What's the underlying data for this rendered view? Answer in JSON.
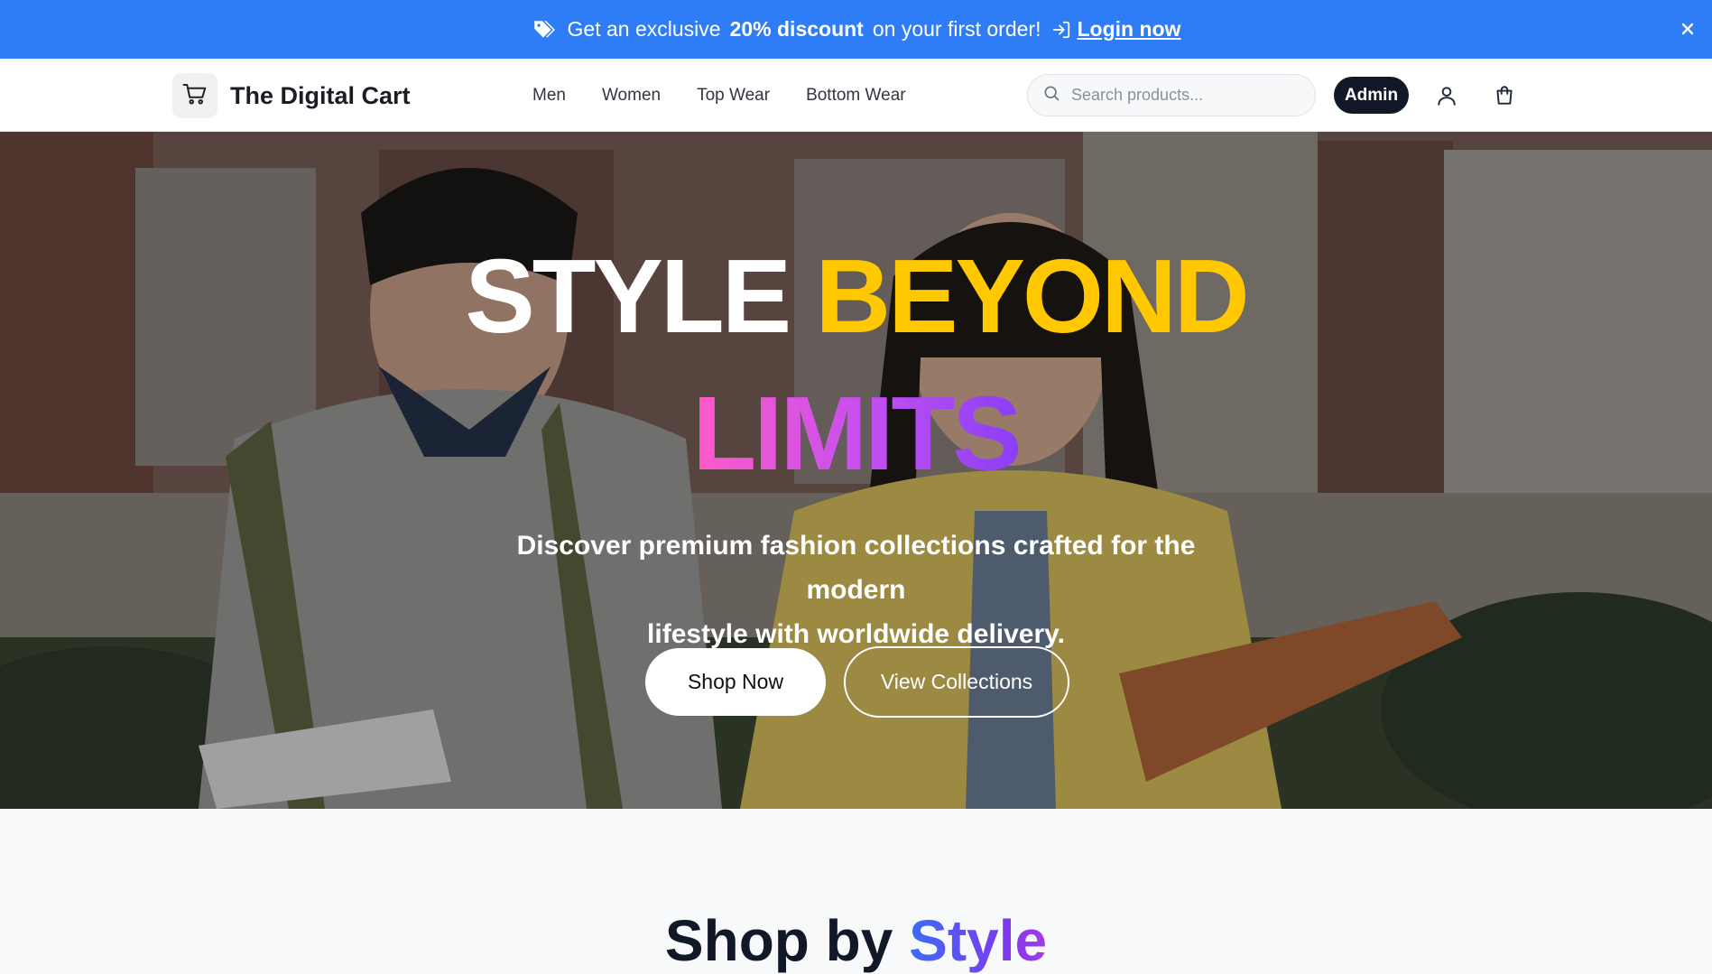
{
  "promo": {
    "text_before": "Get an exclusive",
    "highlight": "20% discount",
    "text_after": "on your first order!",
    "login_label": "Login now",
    "icons": {
      "tag": "tag-icon",
      "login": "login-arrow-icon",
      "close": "close-icon"
    },
    "background_color": "#2f7df6"
  },
  "header": {
    "brand": "The Digital Cart",
    "logo_icon": "shopping-cart-icon",
    "nav": [
      "Men",
      "Women",
      "Top Wear",
      "Bottom Wear"
    ],
    "search": {
      "placeholder": "Search products...",
      "value": "",
      "icon": "search-icon"
    },
    "admin_label": "Admin",
    "icons": {
      "user": "user-icon",
      "cart": "shopping-bag-icon"
    }
  },
  "hero": {
    "headline_part1": "STYLE",
    "headline_part2": "BEYOND",
    "headline_part3": "LIMITS",
    "subtitle_line1": "Discover premium fashion collections crafted for the modern",
    "subtitle_line2": "lifestyle with worldwide delivery.",
    "primary_button": "Shop Now",
    "secondary_button": "View Collections",
    "colors": {
      "accent_yellow": "#ffc800",
      "gradient_pink": "#ff5bc9",
      "gradient_purple": "#8a3ff5"
    }
  },
  "section": {
    "title_part1": "Shop by",
    "title_part2": "Style"
  }
}
